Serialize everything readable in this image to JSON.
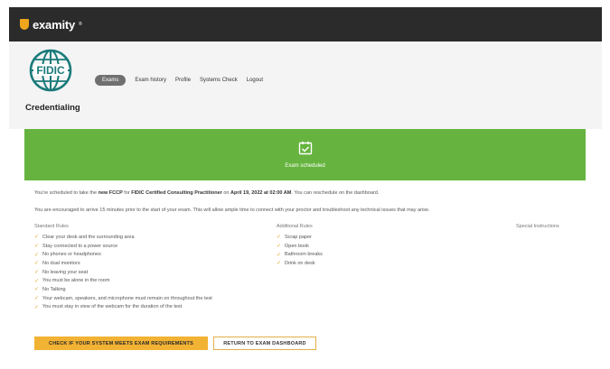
{
  "topbar": {
    "logo_text": "examity",
    "logo_tm": "®"
  },
  "header": {
    "brand_name": "Credentialing",
    "globe_text": "FIDIC",
    "nav": [
      {
        "label": "Exams",
        "active": true
      },
      {
        "label": "Exam history",
        "active": false
      },
      {
        "label": "Profile",
        "active": false
      },
      {
        "label": "Systems Check",
        "active": false
      },
      {
        "label": "Logout",
        "active": false
      }
    ]
  },
  "banner": {
    "text": "Exam scheduled",
    "color": "#66b43f",
    "icon": "calendar-check-icon"
  },
  "main": {
    "scheduled": {
      "pre": "You're scheduled to take the ",
      "exam_code": "new FCCP",
      "mid1": " for ",
      "exam_name": "FIDIC Certified Consulting Practitioner",
      "mid2": " on ",
      "datetime": "April 19, 2022 at 02:00 AM",
      "post": ". You can reschedule on the dashboard."
    },
    "advice": "You are encouraged to arrive 15 minutes prior to the start of your exam. This will allow ample time to connect with your proctor and troubleshoot any technical issues that may arise.",
    "standard_rules": {
      "title": "Standard Rules",
      "items": [
        "Clear your desk and the surrounding area",
        "Stay connected to a power source",
        "No phones or headphones",
        "No dual monitors",
        "No leaving your seat",
        "You must be alone in the room",
        "No Talking",
        "Your webcam, speakers, and microphone must remain on throughout the test",
        "You must stay in view of the webcam for the duration of the test"
      ]
    },
    "additional_rules": {
      "title": "Additional Rules",
      "items": [
        "Scrap paper",
        "Open book",
        "Bathroom breaks",
        "Drink on desk"
      ]
    },
    "special_instructions": {
      "title": "Special Instructions"
    }
  },
  "buttons": {
    "check_system": "CHECK IF YOUR SYSTEM MEETS EXAM REQUIREMENTS",
    "return_dashboard": "RETURN TO EXAM DASHBOARD"
  }
}
